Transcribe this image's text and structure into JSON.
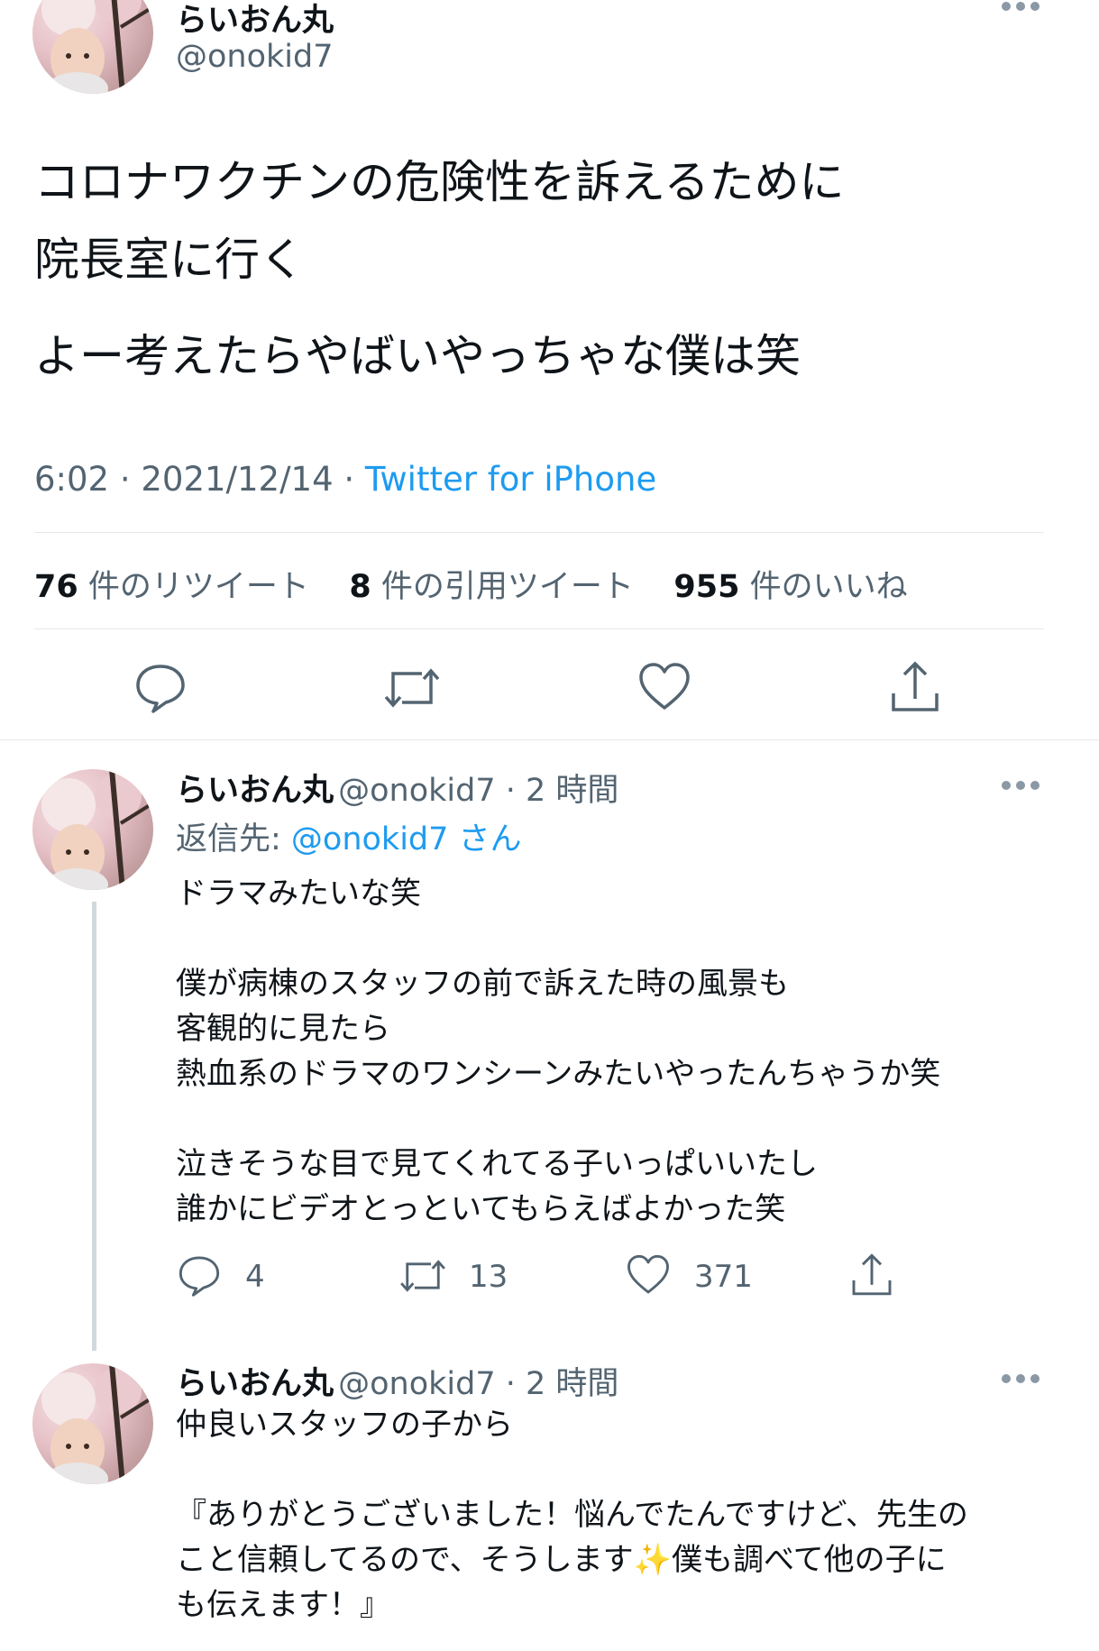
{
  "main_tweet": {
    "author_name": "らいおん丸",
    "author_handle": "@onokid7",
    "text_line1": "コロナワクチンの危険性を訴えるために",
    "text_line2": "院長室に行く",
    "text_line3": "よー考えたらやばいやっちゃな僕は笑",
    "time": "6:02 · 2021/12/14 · ",
    "source": "Twitter for iPhone",
    "stats": {
      "retweets_count": "76",
      "retweets_label": "件のリツイート",
      "quotes_count": "8",
      "quotes_label": "件の引用ツイート",
      "likes_count": "955",
      "likes_label": "件のいいね"
    }
  },
  "replies": [
    {
      "author_name": "らいおん丸",
      "author_handle": "@onokid7 · 2 時間",
      "reply_to_label": "返信先: ",
      "reply_to_handle": "@onokid7 さん",
      "lines": [
        "ドラマみたいな笑",
        "",
        "僕が病棟のスタッフの前で訴えた時の風景も",
        "客観的に見たら",
        "熱血系のドラマのワンシーンみたいやったんちゃうか笑",
        "",
        "泣きそうな目で見てくれてる子いっぱいいたし",
        "誰かにビデオとっといてもらえばよかった笑"
      ],
      "reply_count": "4",
      "retweet_count": "13",
      "like_count": "371"
    },
    {
      "author_name": "らいおん丸",
      "author_handle": "@onokid7 · 2 時間",
      "lines": [
        "仲良いスタッフの子から",
        "",
        "『ありがとうございました！悩んでたんですけど、先生の",
        "こと信頼してるので、そうします✨僕も調べて他の子に",
        "も伝えます！』"
      ]
    }
  ],
  "icons": [
    "more-icon",
    "reply-icon",
    "retweet-icon",
    "like-icon",
    "share-icon"
  ]
}
